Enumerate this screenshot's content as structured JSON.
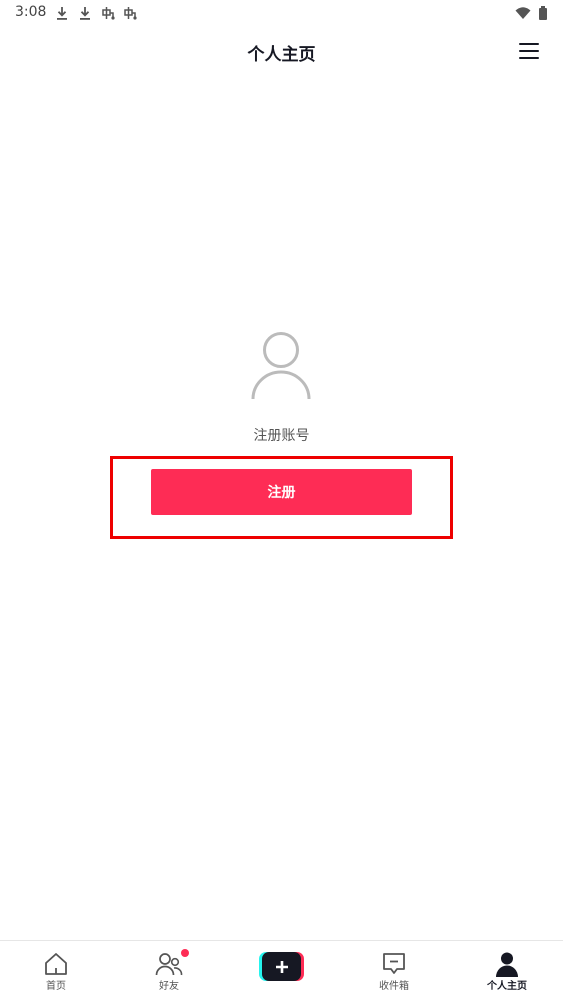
{
  "status_bar": {
    "time": "3:08",
    "left_icons": [
      "download-icon",
      "download-icon",
      "notification-icon",
      "notification-icon"
    ],
    "right_icons": [
      "wifi-icon",
      "battery-icon"
    ]
  },
  "header": {
    "title": "个人主页",
    "menu_icon": "hamburger-menu-icon"
  },
  "main": {
    "avatar_icon": "user-placeholder-icon",
    "register_account_label": "注册账号",
    "register_button_label": "注册",
    "highlight_color": "#ee0000"
  },
  "bottom_nav": {
    "items": [
      {
        "label": "首页",
        "icon": "home-icon"
      },
      {
        "label": "好友",
        "icon": "friends-icon",
        "badge": true
      },
      {
        "label": "",
        "icon": "plus-icon"
      },
      {
        "label": "收件箱",
        "icon": "inbox-icon"
      },
      {
        "label": "个人主页",
        "icon": "profile-icon",
        "active": true
      }
    ]
  },
  "colors": {
    "accent": "#fe2c55",
    "accent_secondary": "#25f4ee",
    "text_primary": "#161823"
  }
}
